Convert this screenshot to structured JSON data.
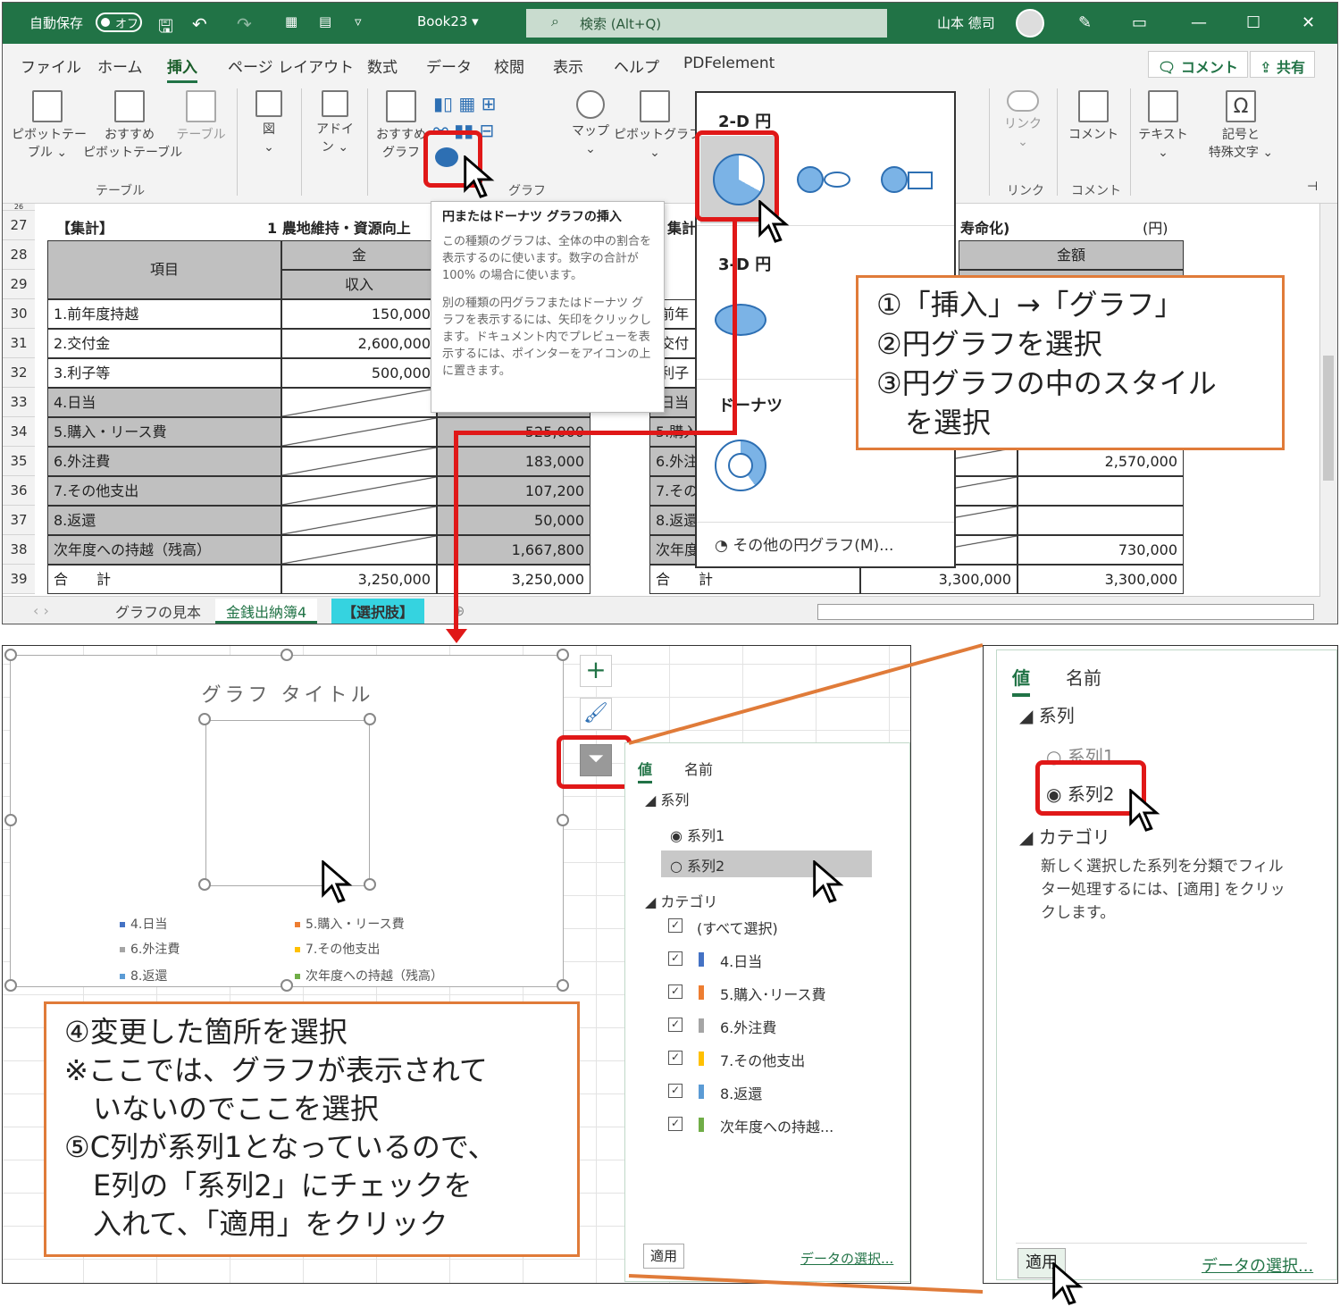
{
  "titlebar": {
    "autosave_label": "自動保存",
    "autosave_state": "オフ",
    "book": "Book23 ▾",
    "search_placeholder": "検索 (Alt+Q)",
    "user": "山本 德司"
  },
  "menu": {
    "items": [
      "ファイル",
      "ホーム",
      "挿入",
      "ページ レイアウト",
      "数式",
      "データ",
      "校閲",
      "表示",
      "ヘルプ",
      "PDFelement"
    ],
    "comment_btn": "コメント",
    "share_btn": "共有"
  },
  "ribbon": {
    "pivot": "ピボットテー\nブル ⌄",
    "recommended_pivot": "おすすめ\nピボットテーブル",
    "table": "テーブル",
    "group_table": "テーブル",
    "figure": "図\n⌄",
    "addin": "アドイ\nン ⌄",
    "recommended_chart": "おすすめ\nグラフ",
    "maps": "マップ\n⌄",
    "pivot_chart": "ピボットグラフ\n⌄",
    "group_chart": "グラフ",
    "link": "リンク\n⌄",
    "group_link": "リンク",
    "comment": "コメント",
    "group_comment": "コメント",
    "text": "テキスト\n⌄",
    "symbol": "記号と\n特殊文字 ⌄"
  },
  "sheet": {
    "rows": [
      "27",
      "28",
      "29",
      "30",
      "31",
      "32",
      "33",
      "34",
      "35",
      "36",
      "37",
      "38",
      "39"
    ],
    "heading_left": "【集計】",
    "heading_mid": "1 農地維持・資源向上",
    "heading_right": "寿命化)",
    "unit": "(円)",
    "col_item": "項目",
    "col_amount": "金",
    "col_amount_right": "金額",
    "col_income": "収入",
    "items": [
      "1.前年度持越",
      "2.交付金",
      "3.利子等",
      "4.日当",
      "5.購入・リース費",
      "6.外注費",
      "7.その他支出",
      "8.返還",
      "次年度への持越（残高）",
      "合　　計"
    ],
    "income": [
      "150,000",
      "2,600,000",
      "500,000",
      "",
      "",
      "",
      "",
      "",
      "",
      "3,250,000"
    ],
    "expense": [
      "",
      "",
      "",
      "",
      "525,000",
      "183,000",
      "107,200",
      "50,000",
      "1,667,800",
      "3,250,000"
    ],
    "right_labels": [
      ".前年",
      ".交付",
      ".利子",
      ".日当",
      "5.購入",
      "6.外注",
      "7.その",
      "8.返還",
      "次年度",
      "合　　計"
    ],
    "right_col1": [
      "",
      "",
      "",
      "",
      "",
      "",
      "",
      "",
      "",
      "3,300,000"
    ],
    "right_col2": [
      "",
      "",
      "",
      "",
      "",
      "2,570,000",
      "",
      "",
      "730,000",
      "3,300,000"
    ],
    "partial_header": "集計"
  },
  "sheet_tabs": [
    "グラフの見本",
    "金銭出納簿4",
    "【選択肢】"
  ],
  "tooltip": {
    "title": "円またはドーナツ グラフの挿入",
    "p1": "この種類のグラフは、全体の中の割合を表示するのに使います。数字の合計が 100% の場合に使います。",
    "p2": "別の種類の円グラフまたはドーナツ グラフを表示するには、矢印をクリックします。ドキュメント内でプレビューを表示するには、ポインターをアイコンの上に置きます。"
  },
  "pie_menu": {
    "h2d": "2-D 円",
    "h3d": "3-D 円",
    "donut": "ドーナツ",
    "more": "その他の円グラフ(M)..."
  },
  "note1": {
    "lines": [
      "①「挿入」→「グラフ」",
      "②円グラフを選択",
      "③円グラフの中のスタイル",
      "　を選択"
    ]
  },
  "chart": {
    "title": "グラフ タイトル",
    "legend": [
      "4.日当",
      "5.購入・リース費",
      "6.外注費",
      "7.その他支出",
      "8.返還",
      "次年度への持越（残高）"
    ],
    "legend_colors": [
      "#4472c4",
      "#ed7d31",
      "#a5a5a5",
      "#ffc000",
      "#5b9bd5",
      "#70ad47"
    ]
  },
  "note2": {
    "lines": [
      "④変更した箇所を選択",
      "※ここでは、グラフが表示されて",
      "　いないのでここを選択",
      "⑤C列が系列1となっているので、",
      "　E列の「系列2」にチェックを",
      "　入れて、「適用」をクリック"
    ]
  },
  "filter": {
    "tab_values": "値",
    "tab_names": "名前",
    "series_header": "系列",
    "series": [
      "系列1",
      "系列2"
    ],
    "category_header": "カテゴリ",
    "select_all": "(すべて選択)",
    "categories": [
      "4.日当",
      "5.購入･リース費",
      "6.外注費",
      "7.その他支出",
      "8.返還",
      "次年度への持越..."
    ],
    "apply": "適用",
    "select_data": "データの選択..."
  },
  "zoom": {
    "tab_values": "値",
    "tab_names": "名前",
    "series_header": "系列",
    "series": [
      "系列1",
      "系列2"
    ],
    "category_header": "カテゴリ",
    "hint": "新しく選択した系列を分類でフィルター処理するには、[適用] をクリックします。",
    "apply": "適用",
    "select_data": "データの選択..."
  },
  "colors": {
    "excel_green": "#217346",
    "annotation_red": "#e01818",
    "note_border": "#e07b39"
  }
}
